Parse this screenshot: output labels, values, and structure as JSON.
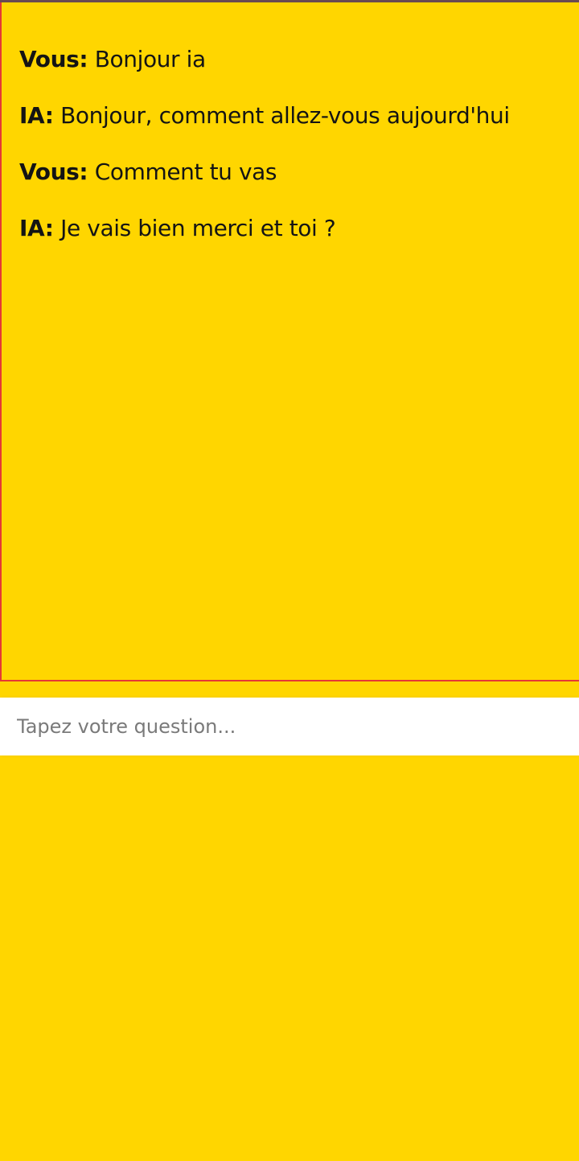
{
  "chat": {
    "messages": [
      {
        "sender": "Vous:",
        "text": " Bonjour ia"
      },
      {
        "sender": "IA:",
        "text": " Bonjour, comment allez-vous aujourd'hui"
      },
      {
        "sender": "Vous:",
        "text": " Comment tu vas"
      },
      {
        "sender": "IA:",
        "text": " Je vais bien merci et toi ?"
      }
    ]
  },
  "input": {
    "value": "",
    "placeholder": "Tapez votre question..."
  },
  "colors": {
    "background": "#FFD600",
    "chat_border": "#E53935",
    "input_background": "#FFFFFF"
  }
}
